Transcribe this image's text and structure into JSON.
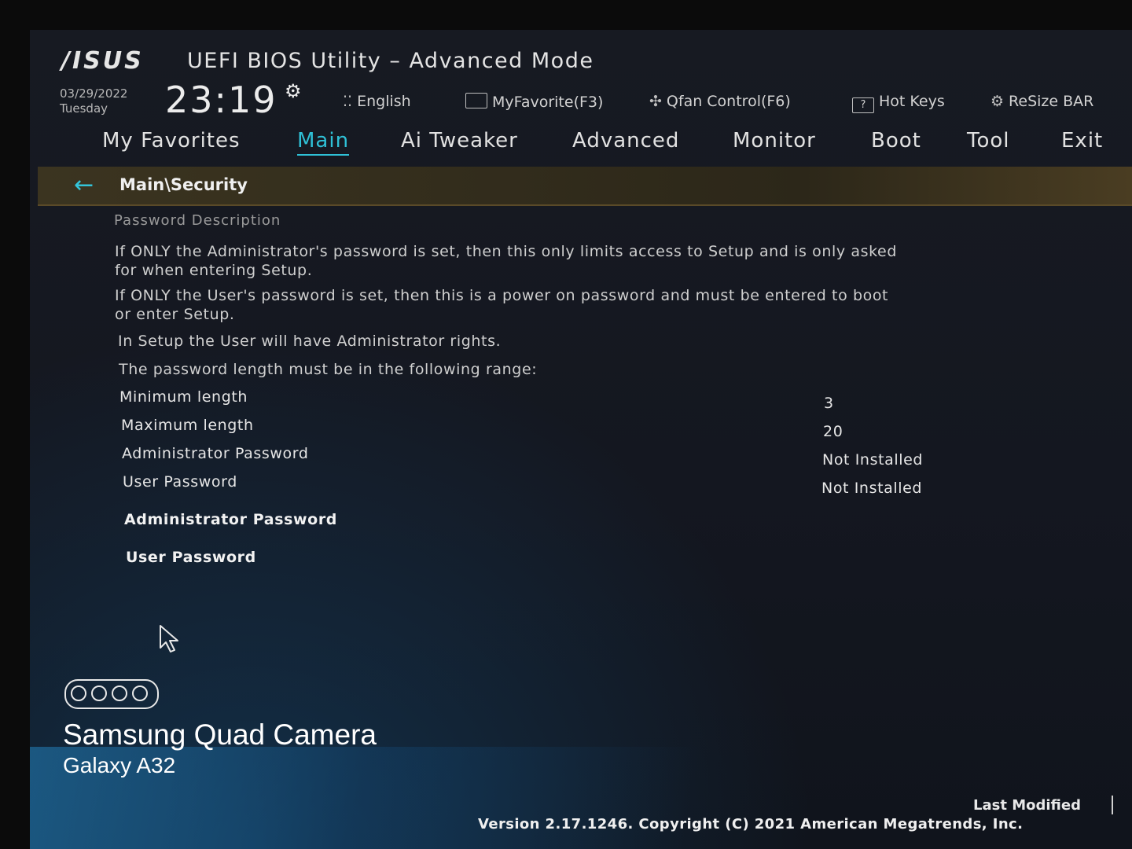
{
  "header": {
    "logo": "/ISUS",
    "title": "UEFI BIOS Utility – Advanced Mode",
    "date": "03/29/2022",
    "day": "Tuesday",
    "time": "23:19"
  },
  "toolbar": [
    {
      "label": "English",
      "icon": "globe-icon"
    },
    {
      "label": "MyFavorite(F3)",
      "icon": "favorite-icon"
    },
    {
      "label": "Qfan Control(F6)",
      "icon": "fan-icon"
    },
    {
      "label": "Hot Keys",
      "icon": "hotkeys-icon"
    },
    {
      "label": "ReSize BAR",
      "icon": "resize-bar-icon"
    }
  ],
  "tabs": [
    "My Favorites",
    "Main",
    "Ai Tweaker",
    "Advanced",
    "Monitor",
    "Boot",
    "Tool",
    "Exit"
  ],
  "active_tab": "Main",
  "breadcrumb": "Main\\Security",
  "content": {
    "section_title": "Password Description",
    "paragraphs": [
      "If ONLY the Administrator's password is set, then this only limits access to Setup and is only asked for when entering Setup.",
      "If ONLY the User's password is set, then this is a power on password and must be entered to boot or enter Setup.",
      "In Setup the User will have Administrator rights.",
      "The password length must be in the following range:"
    ],
    "rows": [
      {
        "label": "Minimum length",
        "value": "3"
      },
      {
        "label": "Maximum length",
        "value": "20"
      },
      {
        "label": "Administrator Password",
        "value": "Not Installed"
      },
      {
        "label": "User Password",
        "value": "Not Installed"
      }
    ],
    "actions": [
      "Administrator Password",
      "User Password"
    ]
  },
  "footer": {
    "last_modified": "Last Modified",
    "version": "Version 2.17.1246. Copyright (C) 2021 American Megatrends, Inc."
  },
  "watermark": {
    "title": "Samsung Quad Camera",
    "subtitle": "Galaxy A32"
  },
  "colors": {
    "accent": "#2fc0d6",
    "breadcrumb_bar": "#3b3420",
    "background": "#151922"
  }
}
